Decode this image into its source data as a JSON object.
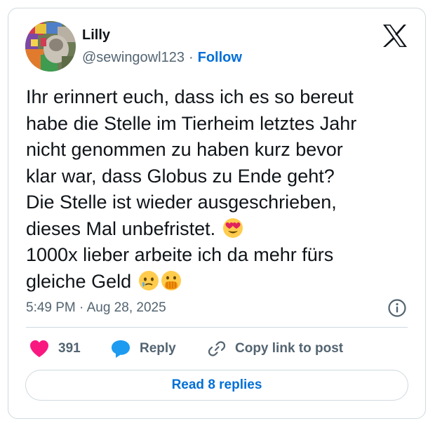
{
  "author": {
    "display_name": "Lilly",
    "handle": "@sewingowl123",
    "separator": "·",
    "follow_label": "Follow"
  },
  "platform_icon": "x-logo-icon",
  "tweet": {
    "lines": [
      "Ihr erinnert euch, dass ich es so bereut",
      "habe die Stelle im Tierheim letztes Jahr",
      "nicht genommen zu haben kurz bevor",
      "klar war, dass Globus zu Ende geht?",
      "Die Stelle ist wieder ausgeschrieben,",
      "dieses Mal unbefristet.",
      "1000x lieber arbeite ich da mehr fürs",
      "gleiche Geld"
    ],
    "emojis": [
      "heart-eyes-emoji",
      "face-holding-back-tears-emoji",
      "face-with-hand-over-mouth-emoji"
    ],
    "timestamp": "5:49 PM · Aug 28, 2025"
  },
  "actions": {
    "like_count": "391",
    "reply_label": "Reply",
    "copy_link_label": "Copy link to post"
  },
  "read_replies_label": "Read 8 replies",
  "colors": {
    "accent": "#006fd6",
    "like": "#f91880",
    "reply_icon": "#1d9bf0",
    "secondary_text": "#536471",
    "border": "#cfd9de"
  }
}
